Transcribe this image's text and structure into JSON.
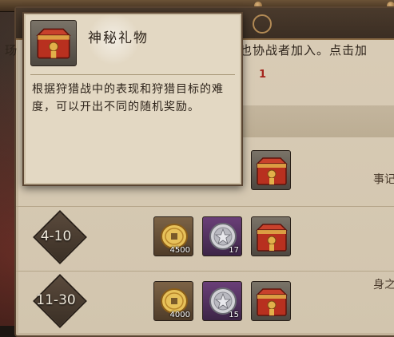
{
  "background": {
    "description_partial": "也协战者加入。点击加",
    "left_clipped_char": "玚",
    "red_marker": "1",
    "right_clipped_1": "事记",
    "right_clipped_2": "身之"
  },
  "tooltip": {
    "icon": "gift-box-icon",
    "name": "神秘礼物",
    "description": "根据狩猎战中的表现和狩猎目标的难度，可以开出不同的随机奖励。"
  },
  "rows": [
    {
      "rank": "",
      "rewards": [
        {
          "icon": "gift-box-icon",
          "count": ""
        }
      ]
    },
    {
      "rank": "4-10",
      "rewards": [
        {
          "icon": "coin-icon",
          "count": "4500"
        },
        {
          "icon": "silver-coin-icon",
          "count": "17"
        },
        {
          "icon": "gift-box-icon",
          "count": ""
        }
      ]
    },
    {
      "rank": "11-30",
      "rewards": [
        {
          "icon": "coin-icon",
          "count": "4000"
        },
        {
          "icon": "silver-coin-icon",
          "count": "15"
        },
        {
          "icon": "gift-box-icon",
          "count": ""
        }
      ]
    }
  ],
  "colors": {
    "parchment": "#d9ccb6",
    "frame": "#5a4532",
    "gift_red": "#b8301f",
    "gift_gold": "#e2b04a"
  }
}
